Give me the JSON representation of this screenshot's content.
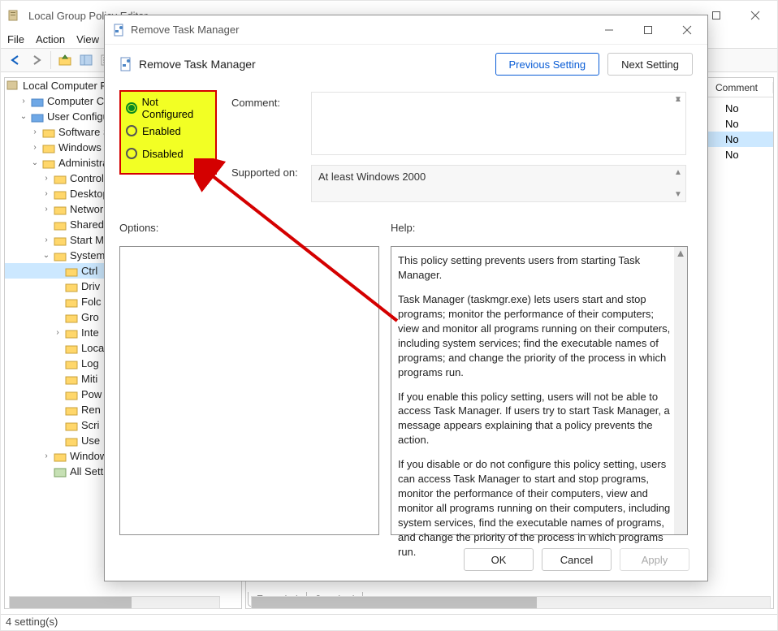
{
  "gp": {
    "title": "Local Group Policy Editor",
    "menu": {
      "file": "File",
      "action": "Action",
      "view": "View"
    },
    "right_header": {
      "comment": "Comment"
    },
    "right_items": [
      "No",
      "No",
      "No",
      "No"
    ],
    "tabs": {
      "extended": "Extended",
      "standard": "Standard"
    },
    "status": "4 setting(s)",
    "tree": {
      "root": "Local Computer Po",
      "computer": "Computer Con",
      "user": "User Configura",
      "software": "Software Se",
      "windows_settings": "Windows S",
      "admin": "Administrat",
      "control": "Control",
      "desktop": "Desktop",
      "network": "Network",
      "shared": "Shared",
      "startm": "Start M",
      "system": "System",
      "ctrl": "Ctrl",
      "driv": "Driv",
      "folc": "Folc",
      "gro": "Gro",
      "inte": "Inte",
      "loca": "Loca",
      "logi": "Log",
      "miti": "Miti",
      "pow": "Pow",
      "ren": "Ren",
      "scri": "Scri",
      "use": "Use",
      "windowc": "Window",
      "allsetti": "All Setti"
    }
  },
  "dlg": {
    "window_title": "Remove Task Manager",
    "name": "Remove Task Manager",
    "nav_prev": "Previous Setting",
    "nav_next": "Next Setting",
    "radio_notconf": "Not Configured",
    "radio_enabled": "Enabled",
    "radio_disabled": "Disabled",
    "comment_label": "Comment:",
    "supported_label": "Supported on:",
    "supported_value": "At least Windows 2000",
    "options_label": "Options:",
    "help_label": "Help:",
    "help_p1": "This policy setting prevents users from starting Task Manager.",
    "help_p2": "Task Manager (taskmgr.exe) lets users start and stop programs; monitor the performance of their computers; view and monitor all programs running on their computers, including system services; find the executable names of programs; and change the priority of the process in which programs run.",
    "help_p3": "If you enable this policy setting, users will not be able to access Task Manager. If users try to start Task Manager, a message appears explaining that a policy prevents the action.",
    "help_p4": "If you disable or do not configure this policy setting, users can access Task Manager to  start and stop programs, monitor the performance of their computers, view and monitor all programs running on their computers, including system services, find the executable names of programs, and change the priority of the process in which programs run.",
    "ok": "OK",
    "cancel": "Cancel",
    "apply": "Apply"
  }
}
